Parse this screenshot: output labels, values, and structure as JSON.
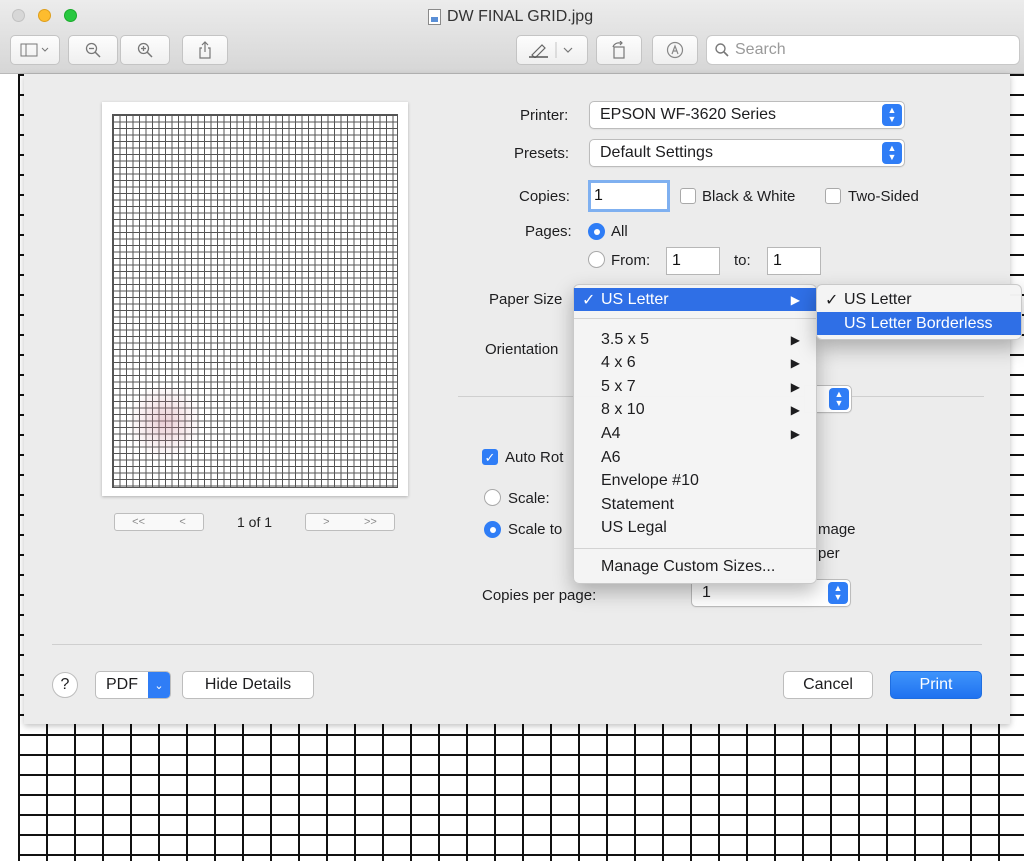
{
  "window": {
    "title": "DW FINAL GRID.jpg"
  },
  "toolbar": {
    "search_placeholder": "Search"
  },
  "preview": {
    "page_count": "1 of 1",
    "first": "<<",
    "prev": "<",
    "next": ">",
    "last": ">>"
  },
  "form": {
    "printer_label": "Printer:",
    "printer_value": "EPSON WF-3620 Series",
    "presets_label": "Presets:",
    "presets_value": "Default Settings",
    "copies_label": "Copies:",
    "copies_value": "1",
    "bw_label": "Black & White",
    "two_sided_label": "Two-Sided",
    "pages_label": "Pages:",
    "all_label": "All",
    "from_label": "From:",
    "from_value": "1",
    "to_label": "to:",
    "to_value": "1",
    "paper_size_label": "Paper Size",
    "orientation_label": "Orientation",
    "auto_rotate_label": "Auto Rot",
    "scale_label": "Scale:",
    "scale_to_label": "Scale to",
    "image_label": "mage",
    "paper_label": "per",
    "copies_per_page_label": "Copies per page:",
    "copies_per_page_value": "1"
  },
  "buttons": {
    "help": "?",
    "pdf": "PDF",
    "hide_details": "Hide Details",
    "cancel": "Cancel",
    "print": "Print"
  },
  "paper_menu": {
    "selected": "US Letter",
    "items": [
      "3.5 x 5",
      "4 x 6",
      "5 x 7",
      "8 x 10",
      "A4",
      "A6",
      "Envelope #10",
      "Statement",
      "US Legal"
    ],
    "manage": "Manage Custom Sizes..."
  },
  "submenu": {
    "items": [
      "US Letter",
      "US Letter Borderless"
    ],
    "checked": "US Letter",
    "highlighted": "US Letter Borderless"
  },
  "colors": {
    "accent": "#2f6fe6"
  }
}
